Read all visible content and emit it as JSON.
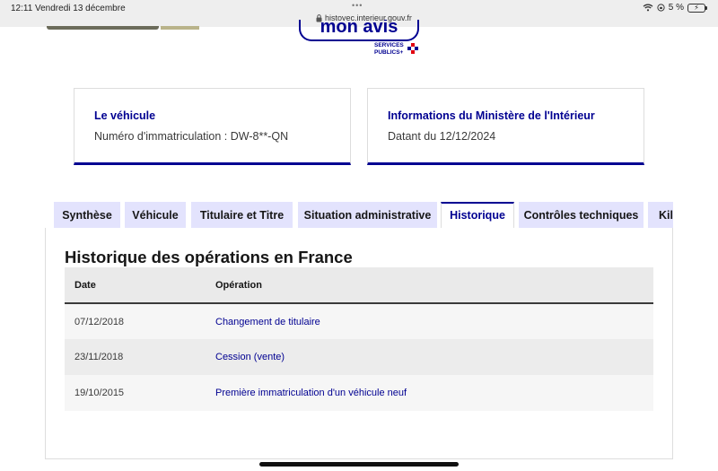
{
  "status_bar": {
    "time": "12:11",
    "date": "Vendredi 13 décembre",
    "url": "histovec.interieur.gouv.fr",
    "battery": "5 %"
  },
  "header": {
    "avis_button": "mon avis",
    "services_publics": "SERVICES PUBLICS+"
  },
  "cards": [
    {
      "title": "Le véhicule",
      "text": "Numéro d'immatriculation : DW-8**-QN"
    },
    {
      "title": "Informations du Ministère de l'Intérieur",
      "text": "Datant du 12/12/2024"
    }
  ],
  "tabs": [
    {
      "label": "Synthèse"
    },
    {
      "label": "Véhicule"
    },
    {
      "label": "Titulaire et Titre"
    },
    {
      "label": "Situation administrative"
    },
    {
      "label": "Historique"
    },
    {
      "label": "Contrôles techniques"
    },
    {
      "label": "Kilo"
    }
  ],
  "active_tab": "Historique",
  "main": {
    "section_title": "Historique des opérations en France",
    "columns": [
      "Date",
      "Opération"
    ],
    "rows": [
      {
        "date": "07/12/2018",
        "operation": "Changement de titulaire"
      },
      {
        "date": "23/11/2018",
        "operation": "Cession (vente)"
      },
      {
        "date": "19/10/2015",
        "operation": "Première immatriculation d'un véhicule neuf"
      }
    ]
  },
  "colors": {
    "brand_blue": "#000091",
    "tab_background": "#e3e3fd",
    "marianne_red": "#e1000f"
  }
}
